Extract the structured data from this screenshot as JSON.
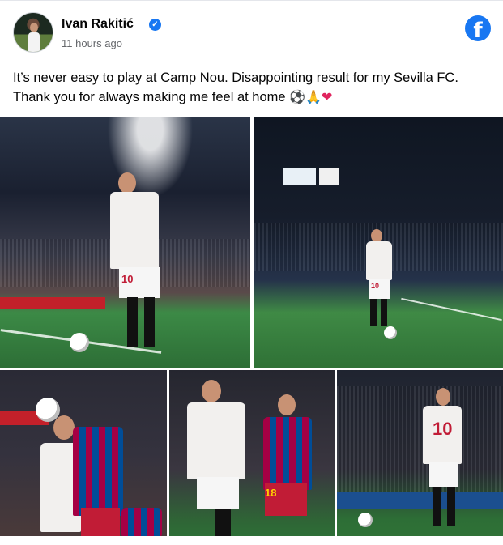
{
  "post": {
    "author_name": "Ivan Rakitić",
    "timestamp": "11 hours ago",
    "text_line1": "It’s never easy to play at Camp Nou. Disappointing result for my Sevilla FC.",
    "text_line2": "Thank you for always making me feel at home",
    "emojis": [
      "⚽",
      "🙏",
      "❤"
    ]
  },
  "photos": [
    {
      "id": "photo-1",
      "subject": "player-clapping-corner",
      "shirt_number": "10"
    },
    {
      "id": "photo-2",
      "subject": "player-raising-hand-corner",
      "shirt_number": "10"
    },
    {
      "id": "photo-3",
      "subject": "header-duel"
    },
    {
      "id": "photo-4",
      "subject": "player-running-with-opponent",
      "shirt_number": "18"
    },
    {
      "id": "photo-5",
      "subject": "player-walking-back",
      "shirt_number": "10"
    }
  ],
  "icons": {
    "verified": "verified-badge-icon",
    "facebook": "facebook-logo-icon"
  },
  "colors": {
    "facebook_blue": "#1877f2",
    "name_text": "#050505",
    "secondary_text": "#65676b",
    "heart": "#e0245e"
  }
}
